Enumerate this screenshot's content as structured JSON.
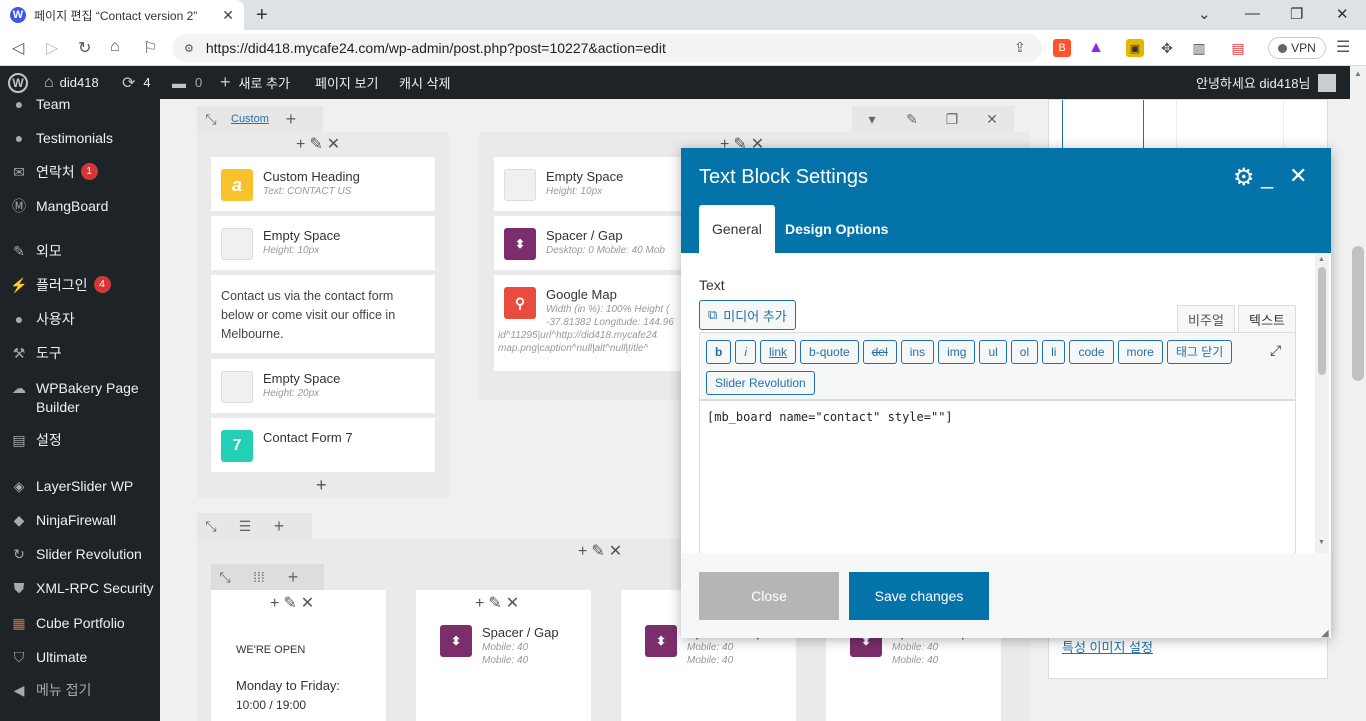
{
  "browser": {
    "tab_title": "페이지 편집 “Contact version 2”",
    "url": "https://did418.mycafe24.com/wp-admin/post.php?post=10227&action=edit",
    "vpn_label": "VPN"
  },
  "adminbar": {
    "site": "did418",
    "updates": "4",
    "comments": "0",
    "new": "새로 추가",
    "view": "페이지 보기",
    "cache": "캐시 삭제",
    "greeting": "안녕하세요 did418님"
  },
  "sidebar": {
    "items": [
      {
        "label": "Team"
      },
      {
        "label": "Testimonials"
      },
      {
        "label": "연락처",
        "badge": "1"
      },
      {
        "label": "MangBoard"
      },
      {
        "label": "외모"
      },
      {
        "label": "플러그인",
        "badge": "4"
      },
      {
        "label": "사용자"
      },
      {
        "label": "도구"
      },
      {
        "label": "WPBakery Page Builder"
      },
      {
        "label": "설정"
      },
      {
        "label": "LayerSlider WP"
      },
      {
        "label": "NinjaFirewall"
      },
      {
        "label": "Slider Revolution"
      },
      {
        "label": "XML-RPC Security"
      },
      {
        "label": "Cube Portfolio"
      },
      {
        "label": "Ultimate"
      },
      {
        "label": "메뉴 접기"
      }
    ]
  },
  "editor": {
    "row_custom_label": "Custom",
    "col1": {
      "heading_title": "Custom Heading",
      "heading_sub": "Text: CONTACT US",
      "empty1_title": "Empty Space",
      "empty1_sub": "Height: 10px",
      "text": "Contact us via the contact form below or come visit our office in Melbourne.",
      "empty2_title": "Empty Space",
      "empty2_sub": "Height: 20px",
      "cf7_title": "Contact Form 7"
    },
    "col2": {
      "empty_title": "Empty Space",
      "empty_sub": "Height: 10px",
      "spacer_title": "Spacer / Gap",
      "spacer_sub": "Desktop: 0   Mobile: 40   Mob",
      "map_title": "Google Map",
      "map_sub1": "Width (in %): 100%  Height (",
      "map_sub2": "-37.81382  Longitude: 144.96",
      "map_sub3": "id^11295|url^http://did418.mycafe24",
      "map_sub4": "map.png|caption^null|alt^null|title^"
    },
    "row2": {
      "open_title": "WE'RE OPEN",
      "hours_label": "Monday to Friday:",
      "hours_value": "10:00 / 19:00",
      "spacer_title": "Spacer / Gap",
      "spacer_sub1": "Mobile: 40",
      "spacer_sub2": "Mobile: 40"
    }
  },
  "modal": {
    "title": "Text Block Settings",
    "tab_general": "General",
    "tab_design": "Design Options",
    "text_label": "Text",
    "media_button": "미디어 추가",
    "mode_visual": "비주얼",
    "mode_text": "텍스트",
    "toolbar": [
      "b",
      "i",
      "link",
      "b-quote",
      "del",
      "ins",
      "img",
      "ul",
      "ol",
      "li",
      "code",
      "more",
      "태그 닫기"
    ],
    "slider_button": "Slider Revolution",
    "content": "[mb_board name=\"contact\" style=\"\"]",
    "close_label": "Close",
    "save_label": "Save changes"
  },
  "rightpanel": {
    "featured_link": "특성 이미지 설정"
  },
  "colors": {
    "admin_dark": "#1d2327",
    "modal_blue": "#0473aa",
    "badge_red": "#d63638"
  }
}
